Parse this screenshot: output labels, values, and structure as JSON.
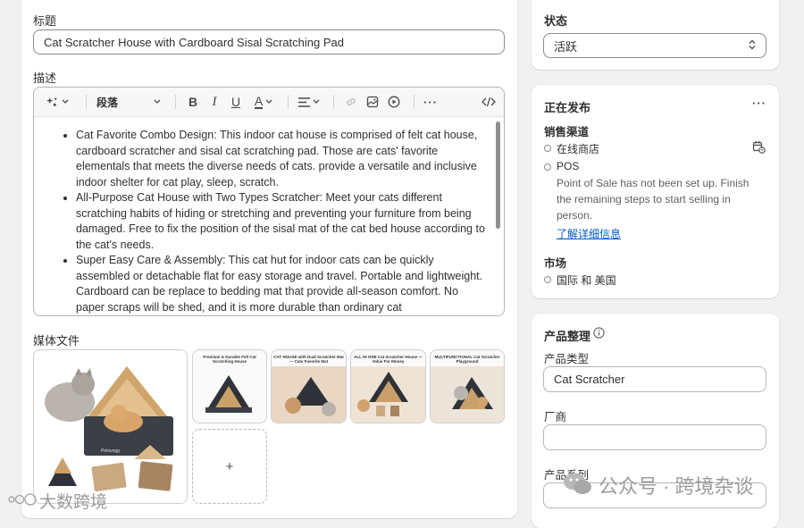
{
  "title_section": {
    "label": "标题",
    "value": "Cat Scratcher House with Cardboard Sisal Scratching Pad"
  },
  "description": {
    "label": "描述",
    "toolbar": {
      "paragraph_style": "段落"
    },
    "bullets": [
      "Cat Favorite Combo Design: This indoor cat house is comprised of felt cat house, cardboard scratcher and sisal cat scratching pad. Those are cats' favorite elementals that meets the diverse needs of cats. provide a versatile and inclusive indoor shelter for cat play, sleep, scratch.",
      "All-Purpose Cat House with Two Types Scratcher: Meet your cats different scratching habits of hiding or stretching and preventing your furniture from being damaged. Free to fix the position of the sisal mat of the cat bed house according to the cat's needs.",
      "Super Easy Care & Assembly: This cat hut for indoor cats can be quickly assembled or detachable flat for easy storage and travel. Portable and lightweight. Cardboard can be replace to bedding mat that provide all-season comfort. No paper scraps will be shed, and it is more durable than ordinary cat"
    ]
  },
  "media": {
    "label": "媒体文件",
    "main_image_brand": "Petsvogg",
    "thumbnails": [
      {
        "caption": "Premium & Durable Felt Cat Scratching House"
      },
      {
        "caption": "CAT HOUSE with Dual Scratcher Mat — Cats Favorite Mat"
      },
      {
        "caption": "ALL IN ONE Cat Scratcher House — Value For Money"
      },
      {
        "caption": "MULTIFUNCTIONAL Cat Scratcher Playground"
      }
    ],
    "add_label": "+"
  },
  "status": {
    "label": "状态",
    "value": "活跃"
  },
  "publishing": {
    "title": "正在发布",
    "more": "···",
    "channels_title": "销售渠道",
    "channels": [
      {
        "name": "在线商店"
      },
      {
        "name": "POS",
        "note": "Point of Sale has not been set up. Finish the remaining steps to start selling in person.",
        "link": "了解详细信息"
      }
    ],
    "markets_title": "市场",
    "markets_value": "国际 和 美国"
  },
  "organization": {
    "title": "产品整理",
    "type_label": "产品类型",
    "type_value": "Cat Scratcher",
    "vendor_label": "厂商",
    "vendor_value": "",
    "collection_label": "产品系列"
  },
  "watermarks": {
    "left": "大数跨境",
    "right": "公众号 · 跨境杂谈"
  },
  "colors": {
    "link": "#005bd3",
    "border": "#8a8a8a",
    "background": "#f1f1f1"
  }
}
